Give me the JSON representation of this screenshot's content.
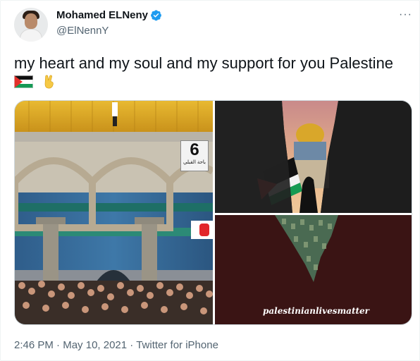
{
  "author": {
    "display_name": "Mohamed ELNeny",
    "handle": "@ElNennY",
    "verified": true,
    "avatar_icon": "profile-photo"
  },
  "more_label": "···",
  "tweet_text": "my heart and my soul and my support for you  Palestine",
  "emojis": [
    "palestine-flag-emoji",
    "victory-hand-emoji"
  ],
  "media": {
    "image1_badge_number": "6",
    "image1_badge_text": "باحة القبلي",
    "image3_caption": "palestinianlivesmatter"
  },
  "meta": {
    "time": "2:46 PM",
    "separator": " · ",
    "date": "May 10, 2021",
    "client": "Twitter for iPhone"
  },
  "colors": {
    "text_primary": "#0f1419",
    "text_secondary": "#536471",
    "verified_blue": "#1d9bf0",
    "border": "#cfd9de"
  }
}
